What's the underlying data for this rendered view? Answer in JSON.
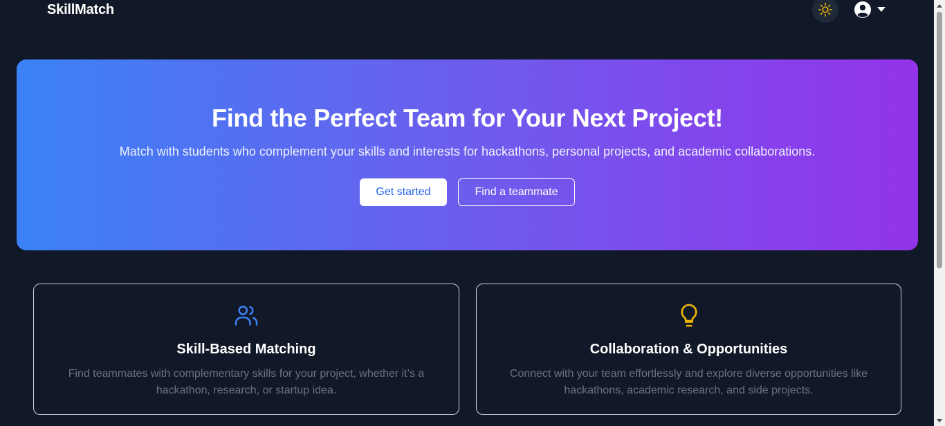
{
  "navbar": {
    "brand": "SkillMatch",
    "theme_icon": "sun-icon",
    "user_icon": "user-circle-icon",
    "caret_icon": "caret-down-icon"
  },
  "hero": {
    "title": "Find the Perfect Team for Your Next Project!",
    "subtitle": "Match with students who complement your skills and interests for hackathons, personal projects, and academic collaborations.",
    "primary_button": "Get started",
    "secondary_button": "Find a teammate",
    "gradient_start": "#3b82f6",
    "gradient_end": "#9333ea"
  },
  "features": [
    {
      "icon": "users-icon",
      "icon_color": "#3b82f6",
      "title": "Skill-Based Matching",
      "description": "Find teammates with complementary skills for your project, whether it’s a hackathon, research, or startup idea."
    },
    {
      "icon": "lightbulb-icon",
      "icon_color": "#eab308",
      "title": "Collaboration & Opportunities",
      "description": "Connect with your team effortlessly and explore diverse opportunities like hackathons, academic research, and side projects."
    }
  ],
  "colors": {
    "background": "#111827",
    "sun": "#eab308",
    "card_border": "#d1d5db",
    "muted_text": "#6b7280"
  }
}
